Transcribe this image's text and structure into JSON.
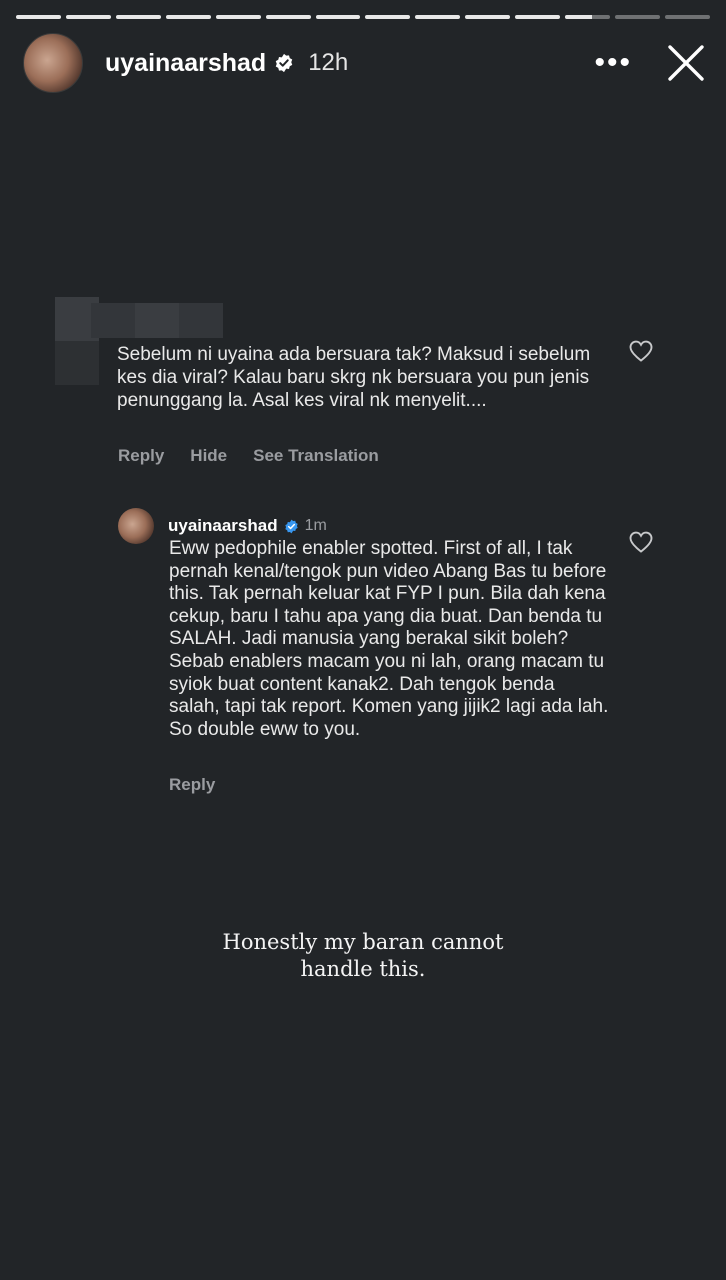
{
  "story": {
    "segments": [
      1,
      1,
      1,
      1,
      1,
      1,
      1,
      1,
      1,
      1,
      1,
      0.6,
      0,
      0
    ],
    "username": "uyainaarshad",
    "time": "12h",
    "more_icon": "more-icon",
    "close_icon": "close-icon"
  },
  "comment": {
    "text": "Sebelum ni uyaina ada bersuara tak? Maksud i sebelum kes dia viral? Kalau baru skrg nk bersuara you pun jenis penunggang la. Asal kes viral nk menyelit....",
    "actions": {
      "reply": "Reply",
      "hide": "Hide",
      "translate": "See Translation"
    }
  },
  "reply": {
    "username": "uyainaarshad",
    "time": "1m",
    "text": "Eww pedophile enabler spotted. First of all, I tak pernah kenal/tengok pun video Abang Bas tu before this. Tak pernah keluar kat FYP I pun. Bila dah kena cekup, baru I tahu apa yang dia buat. Dan benda tu SALAH. Jadi manusia yang berakal sikit boleh? Sebab enablers macam you ni lah, orang macam tu syiok buat content kanak2. Dah tengok benda salah, tapi tak report. Komen yang jijik2 lagi ada lah. So double eww to you.",
    "actions": {
      "reply": "Reply"
    }
  },
  "caption": {
    "line1": "Honestly my baran cannot",
    "line2": "handle this."
  },
  "colors": {
    "background": "#222528",
    "verified_blue": "#3897f0",
    "muted_text": "#9a9ca0"
  }
}
